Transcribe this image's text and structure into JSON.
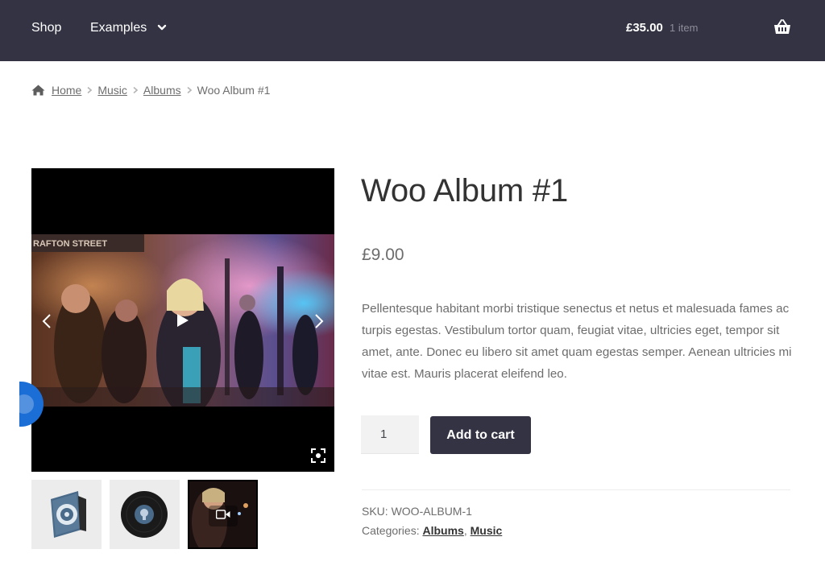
{
  "header": {
    "nav": [
      {
        "label": "Shop"
      },
      {
        "label": "Examples"
      }
    ],
    "cart_total": "£35.00",
    "cart_count": "1 item",
    "colors": {
      "background": "#333344",
      "text": "#ffffff"
    }
  },
  "breadcrumb": {
    "items": [
      "Home",
      "Music",
      "Albums"
    ],
    "current": "Woo Album #1"
  },
  "product": {
    "title": "Woo Album #1",
    "price": "£9.00",
    "description": "Pellentesque habitant morbi tristique senectus et netus et malesuada fames ac turpis egestas. Vestibulum tortor quam, feugiat vitae, ultricies eget, tempor sit amet, ante. Donec eu libero sit amet quam egestas semper. Aenean ultricies mi vitae est. Mauris placerat eleifend leo.",
    "quantity": "1",
    "add_to_cart_label": "Add to cart",
    "sku_label": "SKU:",
    "sku": "WOO-ALBUM-1",
    "categories_label": "Categories:",
    "categories": [
      "Albums",
      "Music"
    ],
    "categories_separator": ","
  },
  "gallery": {
    "video_overlay_text": "RAFTON STREET",
    "thumbnails": [
      {
        "icon": "album-sleeve-icon"
      },
      {
        "icon": "vinyl-record-icon"
      },
      {
        "icon": "video-camera-icon"
      }
    ]
  },
  "colors": {
    "accent_button": "#333344",
    "badge": "#1b6ed6"
  }
}
